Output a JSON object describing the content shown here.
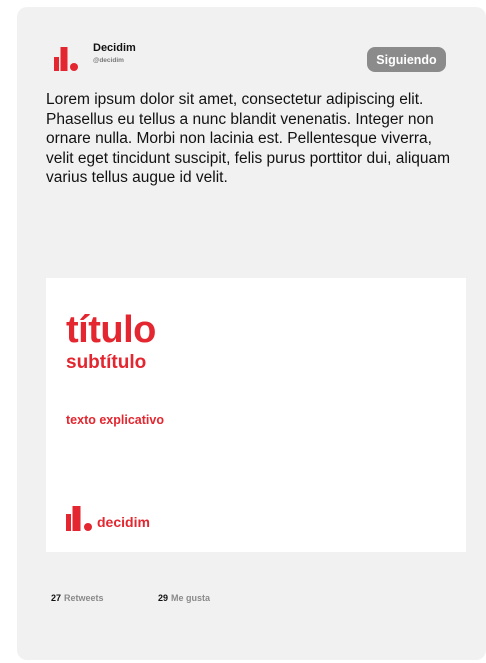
{
  "account": {
    "name": "Decidim",
    "handle": "@decidim"
  },
  "follow_button": {
    "label": "Siguiendo"
  },
  "tweet": {
    "text": "Lorem ipsum dolor sit amet, consectetur adipiscing elit. Phasellus eu tellus a nunc blandit venenatis. Integer non ornare nulla. Morbi non lacinia est. Pellentesque viverra, velit eget tincidunt suscipit, felis purus porttitor dui, aliquam varius tellus augue id velit."
  },
  "media": {
    "title": "título",
    "subtitle": "subtítulo",
    "caption": "texto explicativo",
    "brand_name": "decidim"
  },
  "stats": {
    "retweets_count": "27",
    "retweets_label": "Retweets",
    "likes_count": "29",
    "likes_label": "Me gusta"
  },
  "colors": {
    "brand_red": "#e3262f",
    "card_background": "#f1f1f1",
    "button_background": "#8b8b8b"
  },
  "icons": {
    "avatar": "decidim-logo-icon",
    "brand": "decidim-logo-icon"
  }
}
